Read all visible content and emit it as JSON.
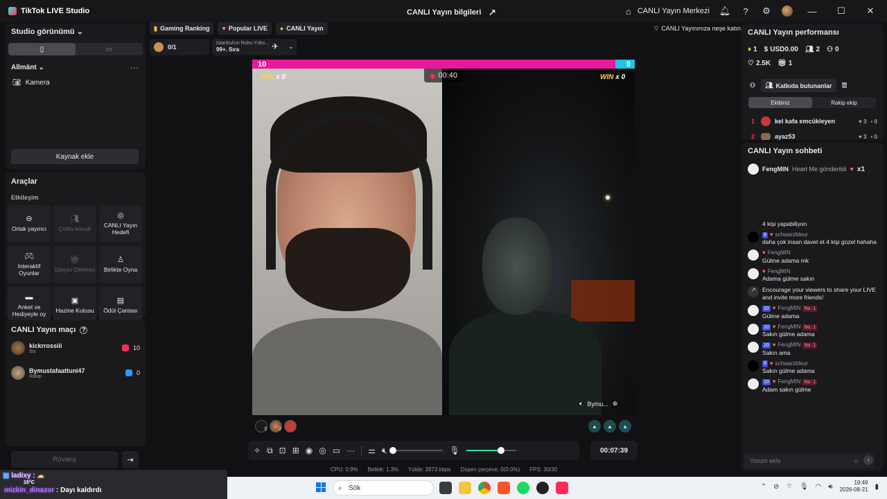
{
  "titlebar": {
    "app_name": "TikTok LIVE Studio",
    "center_title": "CANLI Yayın bilgileri",
    "center_link": "CANLI Yayın Merkezi"
  },
  "left": {
    "studio_view": "Studio görünümü",
    "scene_label": "Allmänt",
    "source_camera": "Kamera",
    "add_source": "Kaynak ekle",
    "tools_title": "Araçlar",
    "tools_sub": "Etkileşim",
    "tiles": [
      {
        "label": "Ortak yayıncı",
        "icon": "link-icon",
        "dim": false
      },
      {
        "label": "Çoklu konuk",
        "icon": "guests-icon",
        "dim": true
      },
      {
        "label": "CANLI Yayın Hedefi",
        "icon": "target-icon",
        "dim": false
      },
      {
        "label": "İnteraktif Oyunlar",
        "icon": "gamepad-icon",
        "dim": false
      },
      {
        "label": "İzleyici Dilekleri",
        "icon": "gift-icon",
        "dim": true
      },
      {
        "label": "Birlikte Oyna",
        "icon": "joystick-icon",
        "dim": false
      },
      {
        "label": "Anket ve Hediyeyle oy",
        "icon": "poll-icon",
        "dim": false
      },
      {
        "label": "Hazine Kutusu",
        "icon": "chest-icon",
        "dim": false
      },
      {
        "label": "Ödül Çantası",
        "icon": "bag-icon",
        "dim": false
      }
    ],
    "match_title": "CANLI Yayın maçı",
    "players": [
      {
        "name": "kickrrossiii",
        "sub": "Siz",
        "score": "10"
      },
      {
        "name": "Bymustafaattuni47",
        "sub": "Rakip",
        "score": "0"
      }
    ],
    "rematch": "Rövanş"
  },
  "chips": {
    "gaming_ranking": "Gaming Ranking",
    "popular_live": "Popular LIVE",
    "canli_yayin": "CANLI Yayın",
    "tip": "CANLI Yayınınıza neşe katın",
    "rank_count": "0/1",
    "rank_region": "İstanbul'un Ruhu-Yüks...",
    "rank_pos": "99+. Sıra"
  },
  "stage": {
    "score_left": "10",
    "score_right": "0",
    "win_left": "x 0",
    "win_right": "x 0",
    "win_word": "WIN",
    "timer": "00:40",
    "opponent_label": "Bymu...",
    "gifter_counts": [
      "3",
      "2",
      ""
    ]
  },
  "controls": {
    "live_timer": "00:07:39",
    "volume_fraction": 0.0,
    "mic_fraction": 0.7
  },
  "stats": {
    "cpu": "CPU:  0.9%",
    "memory": "Bellek:  1.3%",
    "upload": "Yükle:  3973 kbps",
    "dropped": "Düşen çerçeve:  0(0.0%)",
    "fps": "FPS:  30/30"
  },
  "perf": {
    "title": "CANLI Yayın performansı",
    "diamonds": "1",
    "usd": "USD0.00",
    "followers": "2",
    "new_followers": "0",
    "likes": "2.5K",
    "gifts": "1",
    "contributors_btn": "Katkıda bulunanlar",
    "tab_team": "Ekibiniz",
    "tab_rival": "Rakip ekip",
    "rows": [
      {
        "n": "1",
        "name": "kel kafa emcükleyen",
        "hearts": "3",
        "gifts": "0"
      },
      {
        "n": "2",
        "name": "ayaz53",
        "hearts": "3",
        "gifts": "0"
      }
    ]
  },
  "chat": {
    "title": "CANLI Yayın sohbeti",
    "pinned_user": "FengMIN",
    "pinned_text": "Heart Me gönderildi",
    "pinned_count": "x1",
    "messages": [
      {
        "avatar": "none",
        "user": "",
        "lvl": "",
        "badge": "",
        "text": "4 kişi yapabiliyon"
      },
      {
        "avatar": "black",
        "user": "schwarzbleur",
        "lvl": "8",
        "badge": "",
        "text": "daha çok insan davet et 4 kişi güzel hahaha"
      },
      {
        "avatar": "white",
        "user": "FengMIN",
        "lvl": "",
        "badge": "",
        "text": "Gülme adama mk"
      },
      {
        "avatar": "white",
        "user": "FengMIN",
        "lvl": "",
        "badge": "",
        "text": "Adama gülme sakın"
      },
      {
        "avatar": "share",
        "user": "",
        "lvl": "",
        "badge": "",
        "text": "Encourage your viewers to share your LIVE and invite more friends!"
      },
      {
        "avatar": "white",
        "user": "FengMIN",
        "lvl": "10",
        "badge": "No. 1",
        "text": "Gülme adama"
      },
      {
        "avatar": "white",
        "user": "FengMIN",
        "lvl": "10",
        "badge": "No. 1",
        "text": "Sakın gülme adama"
      },
      {
        "avatar": "white",
        "user": "FengMIN",
        "lvl": "10",
        "badge": "No. 1",
        "text": "Sakın ama"
      },
      {
        "avatar": "black",
        "user": "schwarzbleur",
        "lvl": "8",
        "badge": "",
        "text": "Sakın gülme adama"
      },
      {
        "avatar": "white",
        "user": "FengMIN",
        "lvl": "10",
        "badge": "No. 1",
        "text": "Adam sakın gülme"
      }
    ],
    "input_placeholder": "Yorum ekle"
  },
  "overlay": {
    "line1": "ladixy :",
    "temp": "15°C",
    "line2_user": "mizkin_dinazor",
    "line2_text": ": Dayı kaldırdı"
  },
  "taskbar": {
    "search": "Sök",
    "time": "19:49",
    "date": "2026-08-21"
  }
}
